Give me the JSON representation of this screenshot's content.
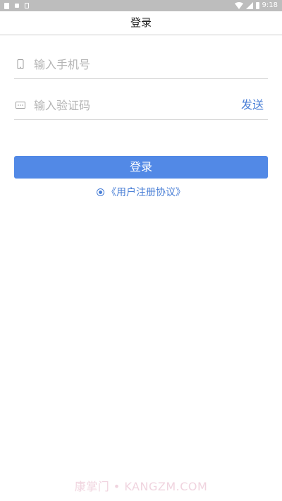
{
  "status_bar": {
    "time": "9:18"
  },
  "header": {
    "title": "登录"
  },
  "form": {
    "phone": {
      "placeholder": "输入手机号",
      "value": ""
    },
    "code": {
      "placeholder": "输入验证码",
      "value": ""
    },
    "send_label": "发送"
  },
  "login_button": {
    "label": "登录"
  },
  "agreement": {
    "label": "《用户注册协议》",
    "checked": true
  },
  "watermark": {
    "text": "康掌门 • KANGZM.COM"
  },
  "colors": {
    "accent": "#4a7fd6",
    "button": "#5289e6",
    "status_bar": "#bdbdbd",
    "placeholder": "#b5b5b5"
  },
  "icons": [
    "phone-icon",
    "message-icon",
    "radio-icon",
    "wifi-icon",
    "signal-icon",
    "battery-icon"
  ]
}
